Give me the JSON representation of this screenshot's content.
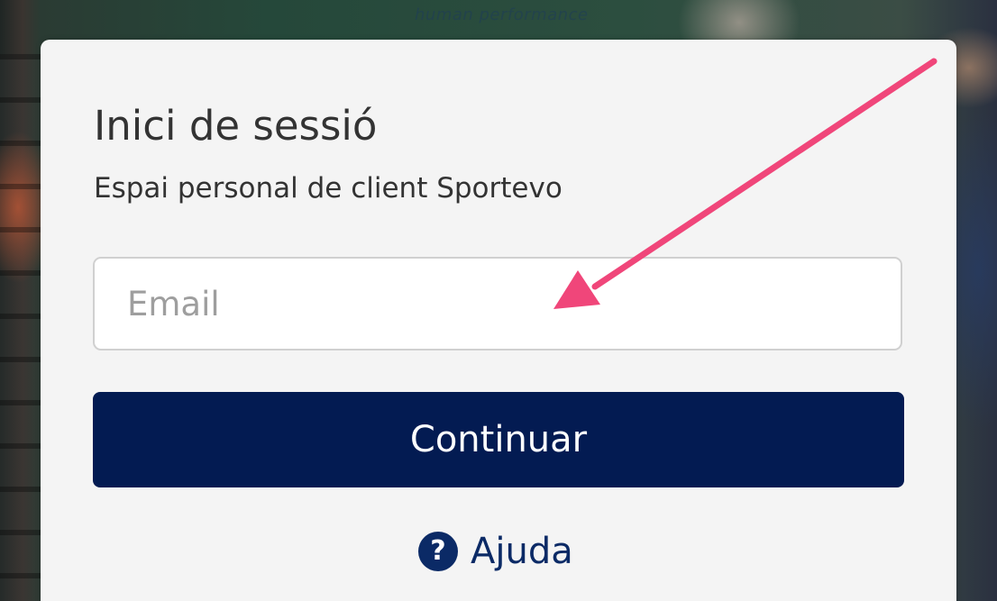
{
  "login": {
    "title": "Inici de sessió",
    "subtitle": "Espai personal de client Sportevo",
    "email_placeholder": "Email",
    "email_value": "",
    "continue_label": "Continuar",
    "help_label": "Ajuda",
    "help_icon": "question-circle-icon"
  },
  "background": {
    "brand_text": "human performance"
  },
  "annotation": {
    "arrow_color": "#f0467a",
    "points_to": "email-input"
  },
  "colors": {
    "primary": "#031b52",
    "card": "#f4f4f4",
    "text": "#333333",
    "help_link": "#0b2a66"
  }
}
